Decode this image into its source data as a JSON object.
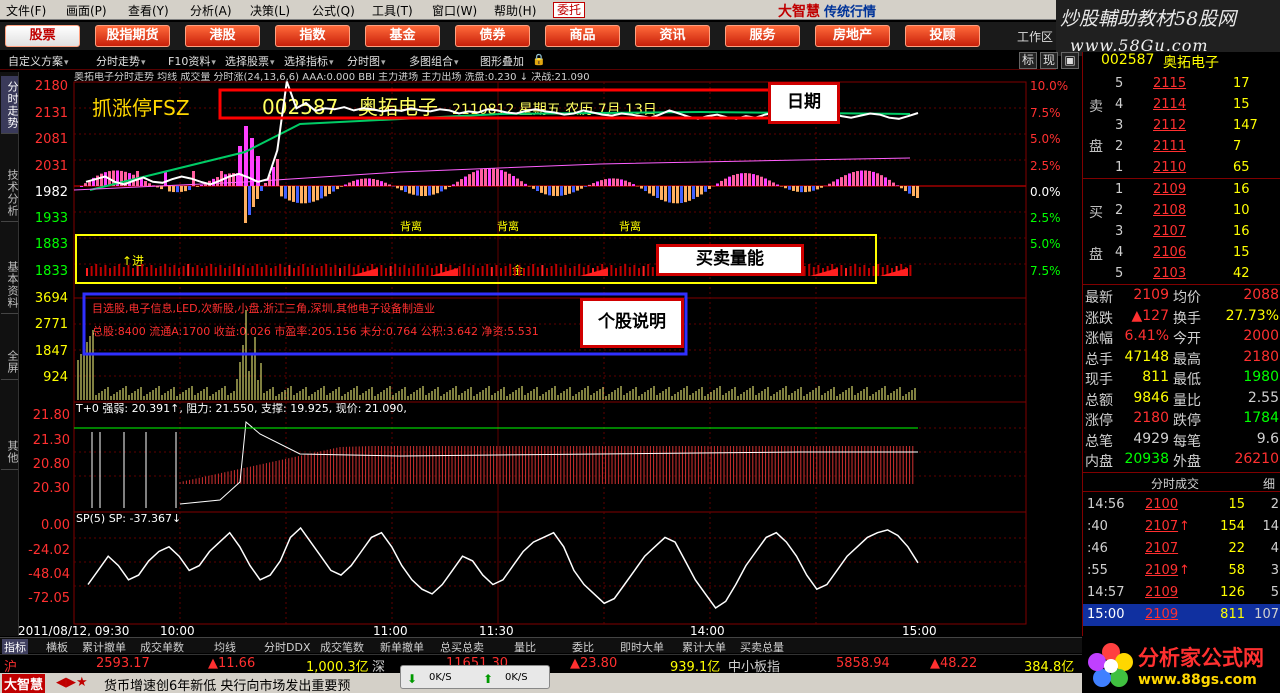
{
  "menu": {
    "items": [
      "文件(F)",
      "画面(P)",
      "查看(Y)",
      "分析(A)",
      "决策(L)",
      "公式(Q)",
      "工具(T)",
      "窗口(W)",
      "帮助(H)"
    ],
    "trade_button": "委托",
    "brand": "大智慧",
    "brand_sub": "传统行情"
  },
  "watermark": {
    "title": "炒股輔助教材58股网",
    "url": "www.58Gu.com"
  },
  "nav_tabs": [
    "股票",
    "股指期货",
    "港股",
    "指数",
    "基金",
    "债券",
    "商品",
    "资讯",
    "服务",
    "房地产",
    "投顾"
  ],
  "nav_extra": "工作区",
  "toolbar": {
    "buttons": [
      "自定义方案",
      "分时走势",
      "F10资料",
      "选择股票",
      "选择指标",
      "分时图",
      "多图组合",
      "图形叠加"
    ],
    "right_toggles": [
      "标",
      "现"
    ]
  },
  "side_tabs": [
    "分时走势",
    "技术分析",
    "基本资料",
    "全屏",
    "其他"
  ],
  "chart": {
    "header_line": "奥拓电子分时走势 均线 成交量 分时涨(24,13,6,6) AAA:0.000 BBI 主力进场 主力出场 洗盘:0.230 ↓ 决战:21.090",
    "formula_name": "抓涨停FSZ",
    "stock_code": "002587",
    "stock_name": "奥拓电子",
    "date_text": "2110812 星期五 农历 7月 13日",
    "price_ticks": [
      "2180",
      "2131",
      "2081",
      "2031",
      "1982",
      "1933",
      "1883",
      "1833"
    ],
    "pct_ticks": [
      "10.0%",
      "7.5%",
      "5.0%",
      "2.5%",
      "0.0%",
      "2.5%",
      "5.0%",
      "7.5%"
    ],
    "volume_ticks": [
      "3694",
      "2771",
      "1847",
      "924"
    ],
    "markers": [
      "背离",
      "背离",
      "背离"
    ],
    "marker_in": "进",
    "marker_jin": "金",
    "description_line1": "目选股,电子信息,LED,次新股,小盘,浙江三角,深圳,其他电子设备制造业",
    "description_line2": "总股:8400 流通A:1700 收益:0.026 市盈率:205.156 未分:0.764 公积:3.642 净资:5.531",
    "indicator_header": "T+0 强弱: 20.391↑, 阻力: 21.550, 支撑: 19.925, 现价: 21.090,",
    "indicator_ticks": [
      "21.80",
      "21.30",
      "20.80",
      "20.30"
    ],
    "sp_header": "SP(5) SP: -37.367↓",
    "sp_ticks": [
      "0.00",
      "-24.02",
      "-48.04",
      "-72.05"
    ],
    "time_labels": [
      "2011/08/12, 09:30",
      "10:00",
      "11:00",
      "11:30",
      "14:00",
      "15:00"
    ],
    "price_series": [
      1990,
      1995,
      2000,
      1990,
      1985,
      1992,
      1998,
      1990,
      1988,
      1995,
      2000,
      1996,
      1990,
      1985,
      1992,
      2000,
      2005,
      1998,
      1990,
      1995,
      2050,
      2181,
      2130,
      2140,
      2125,
      2130,
      2128,
      2132,
      2126,
      2130,
      2128,
      2124,
      2127,
      2125,
      2130,
      2126,
      2124,
      2128,
      2126,
      2120,
      2124,
      2122,
      2128,
      2126,
      2122,
      2120,
      2125,
      2128,
      2124,
      2122,
      2118,
      2120,
      2126,
      2122,
      2118,
      2116,
      2120,
      2118,
      2115,
      2112,
      2118,
      2126,
      2120,
      2114,
      2110,
      2115,
      2118,
      2113,
      2110,
      2115,
      2112,
      2118,
      2122,
      2115,
      2110,
      2112,
      2118,
      2125,
      2120,
      2115,
      2112,
      2116,
      2120,
      2118,
      2112,
      2110,
      2115,
      2121
    ],
    "sp_series": [
      -60,
      -45,
      -30,
      -40,
      -55,
      -50,
      -35,
      -25,
      -20,
      -30,
      -45,
      -40,
      -25,
      -15,
      -5,
      -20,
      -40,
      -55,
      -50,
      -35,
      -10,
      0,
      -15,
      -30,
      -45,
      -50,
      -40,
      -25,
      -10,
      -5,
      -20,
      -40,
      -55,
      -65,
      -70,
      -60,
      -45,
      -30,
      -35,
      -50,
      -60,
      -55,
      -40,
      -25,
      -15,
      -10,
      -5,
      -20,
      -45,
      -60,
      -70,
      -80,
      -75,
      -60,
      -45,
      -30,
      -20,
      -10,
      -15,
      -35,
      -55,
      -70,
      -85,
      -78,
      -60,
      -40,
      -25,
      -10,
      -5,
      -15,
      -30,
      -50,
      -65,
      -60,
      -45,
      -30,
      -20,
      -10,
      -5,
      -2,
      -8,
      -20,
      -37
    ]
  },
  "annotations": {
    "date": "日期",
    "buy_sell": "买卖量能",
    "stock_desc": "个股说明"
  },
  "quote": {
    "head_code": "002587",
    "head_name": "奥拓电子",
    "sell_label": [
      "卖",
      "盘"
    ],
    "buy_label": [
      "买",
      "盘"
    ],
    "sell": [
      {
        "lvl": "5",
        "price": "2115",
        "vol": "17"
      },
      {
        "lvl": "4",
        "price": "2114",
        "vol": "15"
      },
      {
        "lvl": "3",
        "price": "2112",
        "vol": "147"
      },
      {
        "lvl": "2",
        "price": "2111",
        "vol": "7"
      },
      {
        "lvl": "1",
        "price": "2110",
        "vol": "65"
      }
    ],
    "buy": [
      {
        "lvl": "1",
        "price": "2109",
        "vol": "16"
      },
      {
        "lvl": "2",
        "price": "2108",
        "vol": "10"
      },
      {
        "lvl": "3",
        "price": "2107",
        "vol": "16"
      },
      {
        "lvl": "4",
        "price": "2106",
        "vol": "15"
      },
      {
        "lvl": "5",
        "price": "2103",
        "vol": "42"
      }
    ],
    "stats": [
      {
        "k1": "最新",
        "v1": "2109",
        "k2": "均价",
        "v2": "2088"
      },
      {
        "k1": "涨跌",
        "v1": "▲127",
        "k2": "换手",
        "v2": "27.73%"
      },
      {
        "k1": "涨幅",
        "v1": "6.41%",
        "k2": "今开",
        "v2": "2000"
      },
      {
        "k1": "总手",
        "v1": "47148",
        "k2": "最高",
        "v2": "2180"
      },
      {
        "k1": "现手",
        "v1": "811",
        "k2": "最低",
        "v2": "1980"
      },
      {
        "k1": "总额",
        "v1": "9846",
        "k2": "量比",
        "v2": "2.55"
      },
      {
        "k1": "涨停",
        "v1": "2180",
        "k2": "跌停",
        "v2": "1784"
      },
      {
        "k1": "总笔",
        "v1": "4929",
        "k2": "每笔",
        "v2": "9.6"
      },
      {
        "k1": "内盘",
        "v1": "20938",
        "k2": "外盘",
        "v2": "26210"
      }
    ],
    "ticks_header": "分时成交",
    "ticks_header_right": "细",
    "ticks": [
      {
        "t": "14:56",
        "p": "2100",
        "v": "15",
        "n": "2",
        "arrow": ""
      },
      {
        "t": ":40",
        "p": "2107",
        "v": "154",
        "n": "14",
        "arrow": "↑"
      },
      {
        "t": ":46",
        "p": "2107",
        "v": "22",
        "n": "4",
        "arrow": ""
      },
      {
        "t": ":55",
        "p": "2109",
        "v": "58",
        "n": "3",
        "arrow": "↑"
      },
      {
        "t": "14:57",
        "p": "2109",
        "v": "126",
        "n": "5",
        "arrow": ""
      },
      {
        "t": "15:00",
        "p": "2109",
        "v": "811",
        "n": "107",
        "arrow": ""
      }
    ]
  },
  "bottom_tabs": [
    "指标",
    "横板",
    "累计撤单",
    "成交单数",
    "均线",
    "分时DDX",
    "成交笔数",
    "新单撤单",
    "总买总卖",
    "量比",
    "委比",
    "即时大单",
    "累计大单",
    "买卖总量"
  ],
  "index_bar": {
    "sh_label": "沪",
    "sh_value": "2593.17",
    "sh_change": "▲11.66",
    "sh_amount": "1,000.3亿",
    "sz_label": "深",
    "sz_value": "11651.30",
    "sz_change": "▲23.80",
    "sz_amount": "939.1亿",
    "sme_label": "中小板指",
    "sme_value": "5858.94",
    "sme_change": "▲48.22",
    "sme_amount": "384.8亿"
  },
  "status_bar": {
    "brand": "大智慧",
    "ticker": "货币增速创6年新低 央行向市场发出重要预",
    "ok1": "0K/S",
    "ok2": "0K/S"
  },
  "logo": {
    "text": "分析家公式网",
    "url": "www.88gs.com"
  },
  "colors": {
    "up": "#ff3030",
    "down": "#00ff00",
    "gridline": "#800000",
    "price_line": "#ffffff",
    "avg_line": "#ffff00",
    "annotation_border": "#d00000"
  }
}
